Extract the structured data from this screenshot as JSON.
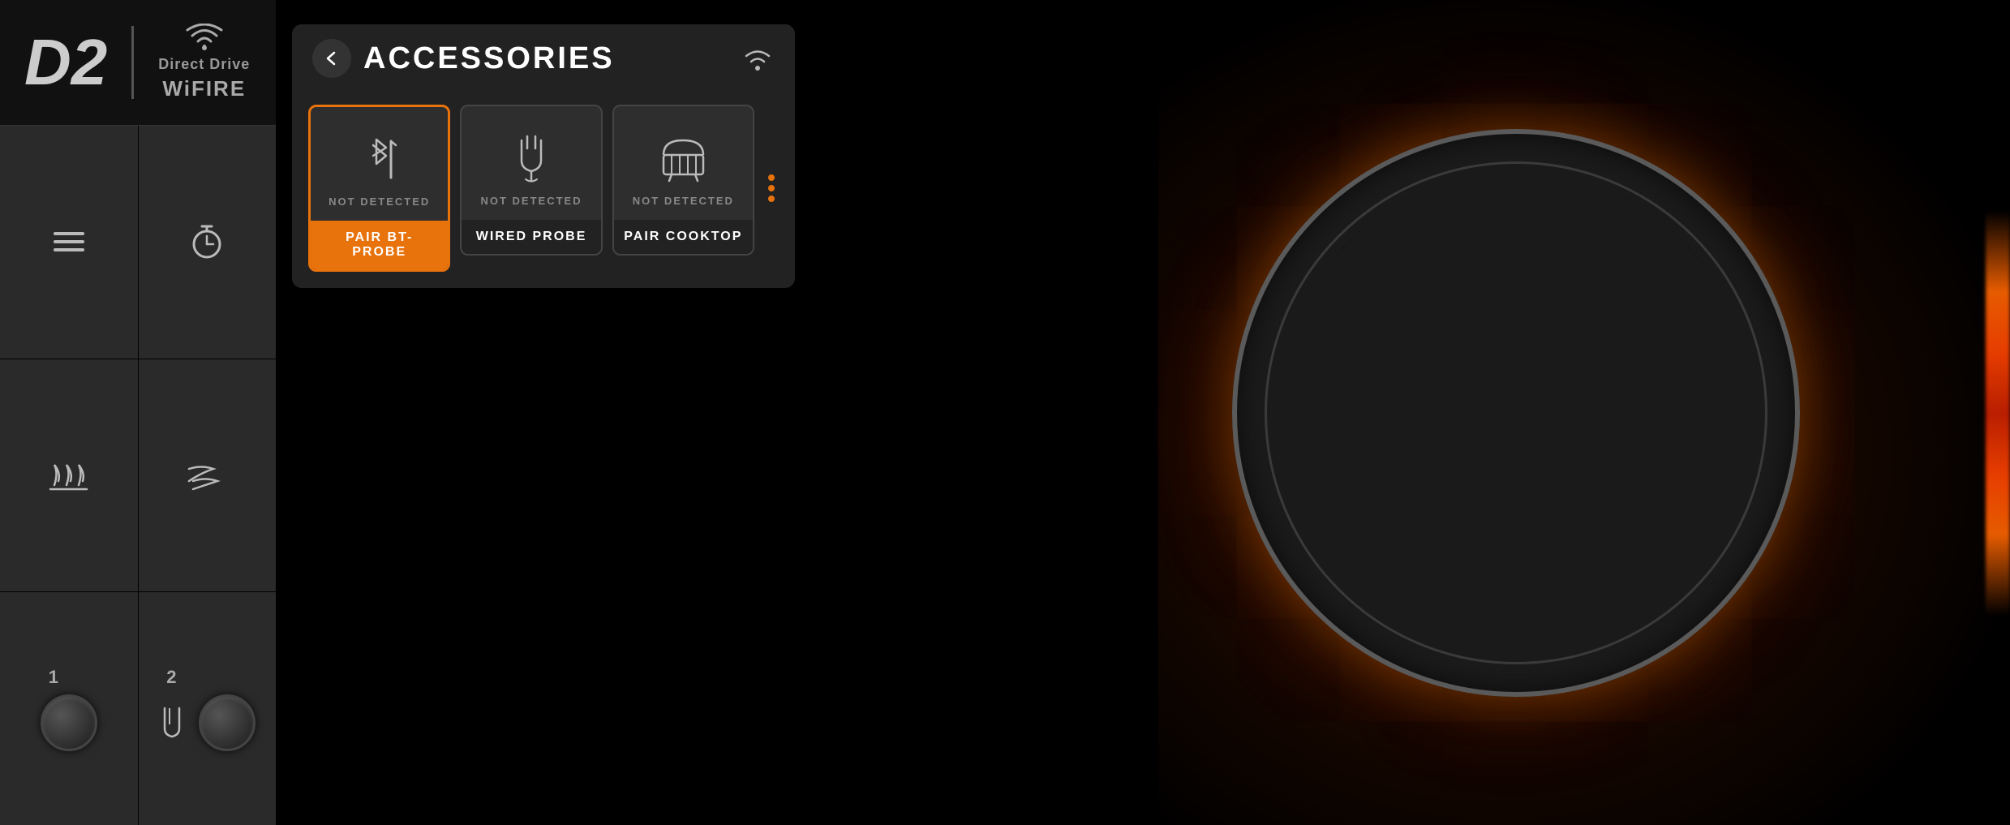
{
  "logo": {
    "d2_text": "D2",
    "direct_drive": "Direct Drive",
    "wifire": "WiFIRE"
  },
  "controls": [
    {
      "id": "menu",
      "icon": "☰",
      "label": ""
    },
    {
      "id": "timer",
      "icon": "◷",
      "label": ""
    },
    {
      "id": "heat",
      "icon": "≋",
      "label": ""
    },
    {
      "id": "fan",
      "icon": "⇌",
      "label": ""
    },
    {
      "id": "knob1",
      "type": "knob",
      "label": "1"
    },
    {
      "id": "probe2",
      "type": "probe-knob",
      "label": "2"
    }
  ],
  "accessories": {
    "title": "ACCESSORIES",
    "back_label": "←",
    "cards": [
      {
        "id": "pair-bt-probe",
        "status": "NOT DETECTED",
        "label": "PAIR BT-PROBE",
        "active": true,
        "icon": "bt-probe"
      },
      {
        "id": "wired-probe",
        "status": "NOT DETECTED",
        "label": "WIRED PROBE",
        "active": false,
        "icon": "wired-probe"
      },
      {
        "id": "pair-cooktop",
        "status": "NOT DETECTED",
        "label": "PAIR COOKTOP",
        "active": false,
        "icon": "cooktop"
      }
    ]
  }
}
